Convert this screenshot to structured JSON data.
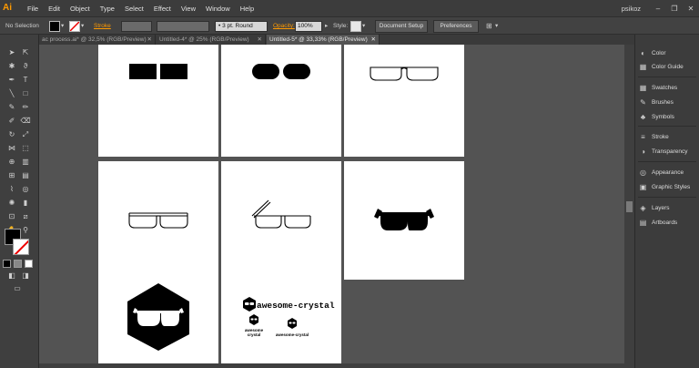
{
  "app": {
    "logo": "Ai",
    "user": "psikoz"
  },
  "menu": [
    "File",
    "Edit",
    "Object",
    "Type",
    "Select",
    "Effect",
    "View",
    "Window",
    "Help"
  ],
  "window_controls": {
    "minimize": "–",
    "restore": "❐",
    "close": "✕"
  },
  "control_bar": {
    "selection": "No Selection",
    "stroke_label": "Stroke",
    "stroke_profile": "• 3 pt. Round",
    "opacity_label": "Opacity:",
    "opacity_value": "100%",
    "style_label": "Style:",
    "document_setup": "Document Setup",
    "preferences": "Preferences"
  },
  "tabs": [
    {
      "label": "ac process.ai* @ 32,5% (RGB/Preview)",
      "active": false
    },
    {
      "label": "Untitled-4* @ 25% (RGB/Preview)",
      "active": false
    },
    {
      "label": "Untitled-5* @ 33,33% (RGB/Preview)",
      "active": true
    }
  ],
  "tab_close": "✕",
  "artboards": {
    "logo_main": "awesome-crystal",
    "logo_small_1_line1": "awesome",
    "logo_small_1_line2": "crystal",
    "logo_small_2": "awesome-crystal"
  },
  "panels": [
    {
      "label": "Color",
      "icon": "color-icon",
      "glyph": "◐"
    },
    {
      "label": "Color Guide",
      "icon": "color-guide-icon",
      "glyph": "▦"
    },
    {
      "label": "Swatches",
      "icon": "swatches-icon",
      "glyph": "▦"
    },
    {
      "label": "Brushes",
      "icon": "brushes-icon",
      "glyph": "✎"
    },
    {
      "label": "Symbols",
      "icon": "symbols-icon",
      "glyph": "♣"
    },
    {
      "label": "Stroke",
      "icon": "stroke-icon",
      "glyph": "≡"
    },
    {
      "label": "Transparency",
      "icon": "transparency-icon",
      "glyph": "◑"
    },
    {
      "label": "Appearance",
      "icon": "appearance-icon",
      "glyph": "◎"
    },
    {
      "label": "Graphic Styles",
      "icon": "graphic-styles-icon",
      "glyph": "▣"
    },
    {
      "label": "Layers",
      "icon": "layers-icon",
      "glyph": "◈"
    },
    {
      "label": "Artboards",
      "icon": "artboards-icon",
      "glyph": "▤"
    }
  ],
  "colors": {
    "accent": "#ff9a00",
    "ui_dark": "#3c3c3c",
    "canvas": "#535353",
    "artboard": "#ffffff"
  }
}
